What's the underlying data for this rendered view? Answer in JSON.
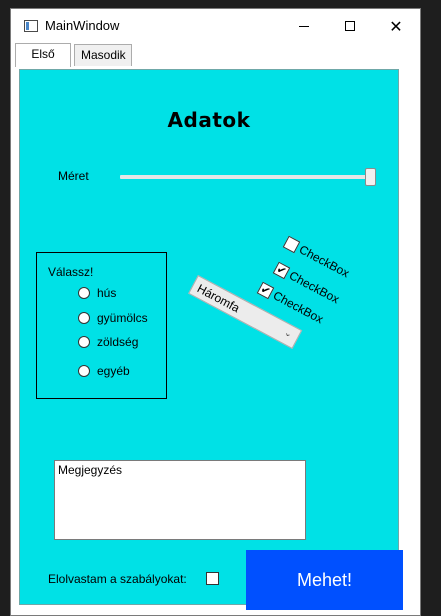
{
  "window": {
    "title": "MainWindow",
    "minimize_icon": "minimize-icon",
    "maximize_icon": "maximize-icon",
    "close_icon": "close-icon"
  },
  "tabs": [
    {
      "label": "Első",
      "selected": true
    },
    {
      "label": "Masodik",
      "selected": false
    }
  ],
  "panel": {
    "background": "#00e1e6",
    "heading": "Adatok",
    "size": {
      "label": "Méret",
      "value_fraction": 1.0
    },
    "group": {
      "label": "Válassz!",
      "options": [
        {
          "label": "hús",
          "checked": false
        },
        {
          "label": "gyümölcs",
          "checked": false
        },
        {
          "label": "zöldség",
          "checked": false
        },
        {
          "label": "egyéb",
          "checked": false
        }
      ]
    },
    "checkboxes": [
      {
        "label": "CheckBox",
        "checked": false
      },
      {
        "label": "CheckBox",
        "checked": true
      },
      {
        "label": "CheckBox",
        "checked": true
      }
    ],
    "combo": {
      "value": "Háromfa"
    },
    "notes": {
      "value": "Megjegyzés"
    },
    "agree": {
      "label": "Elolvastam a szabályokat:",
      "checked": false
    },
    "submit": {
      "label": "Mehet!",
      "color": "#0050ff"
    }
  }
}
